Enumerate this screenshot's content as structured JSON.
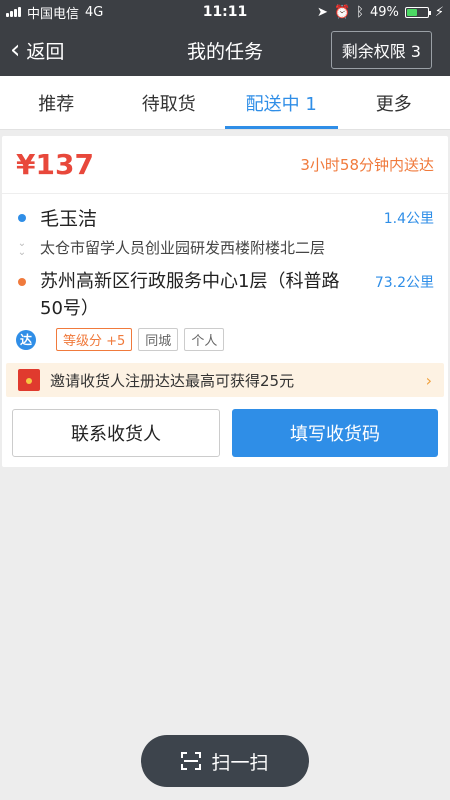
{
  "status_bar": {
    "carrier": "中国电信",
    "network": "4G",
    "time": "11:11",
    "battery": "49%",
    "battery_level": 0.49
  },
  "nav": {
    "back_label": "返回",
    "title": "我的任务",
    "quota_label": "剩余权限 3"
  },
  "tabs": [
    {
      "label": "推荐"
    },
    {
      "label": "待取货"
    },
    {
      "label": "配送中 1"
    },
    {
      "label": "更多"
    }
  ],
  "order": {
    "price": "¥137",
    "eta": "3小时58分钟内送达",
    "sender_name": "毛玉洁",
    "sender_distance": "1.4公里",
    "sender_address": "太仓市留学人员创业园研发西楼附楼北二层",
    "dest_name": "苏州高新区行政服务中心1层（科普路50号）",
    "dest_distance": "73.2公里",
    "logo_text": "达",
    "tags": [
      "等级分 +5",
      "同城",
      "个人"
    ],
    "invite_text": "邀请收货人注册达达最高可获得25元",
    "contact_button": "联系收货人",
    "code_button": "填写收货码"
  },
  "scan": {
    "label": "扫一扫"
  },
  "colors": {
    "accent": "#2f8ee7",
    "price": "#e8483b",
    "eta": "#f07a3c"
  }
}
